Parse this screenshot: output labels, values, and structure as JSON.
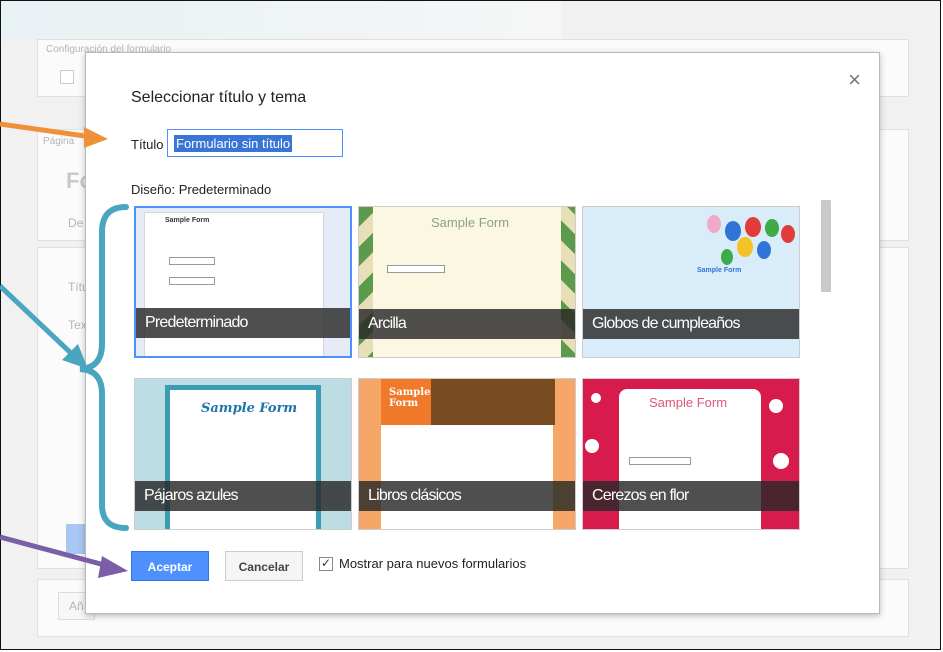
{
  "background": {
    "section_label": "Configuración del formulario",
    "page_label": "Página",
    "title_fragment": "Fo",
    "desc_fragment": "De",
    "field1_fragment": "Títu",
    "field2_fragment": "Tex",
    "add_item_fragment": "Añ"
  },
  "dialog": {
    "title": "Seleccionar título y tema",
    "close_glyph": "×",
    "title_label": "Título",
    "title_value": "Formulario sin título",
    "design_label": "Diseño: Predeterminado",
    "themes": [
      {
        "name": "Predeterminado",
        "selected": true,
        "preview_heading": "Sample Form"
      },
      {
        "name": "Arcilla",
        "selected": false,
        "preview_heading": "Sample Form"
      },
      {
        "name": "Globos de cumpleaños",
        "selected": false,
        "preview_heading": "Sample Form"
      },
      {
        "name": "Pájaros azules",
        "selected": false,
        "preview_heading": "Sample Form"
      },
      {
        "name": "Libros clásicos",
        "selected": false,
        "preview_heading": "Sample Form"
      },
      {
        "name": "Cerezos en flor",
        "selected": false,
        "preview_heading": "Sample Form"
      }
    ],
    "accept_label": "Aceptar",
    "cancel_label": "Cancelar",
    "show_new_forms_label": "Mostrar para nuevos formularios",
    "show_new_forms_checked": true,
    "check_glyph": "✓"
  },
  "annotation_colors": {
    "orange": "#f0913a",
    "teal": "#4aa6bf",
    "purple": "#7a5fa8"
  }
}
